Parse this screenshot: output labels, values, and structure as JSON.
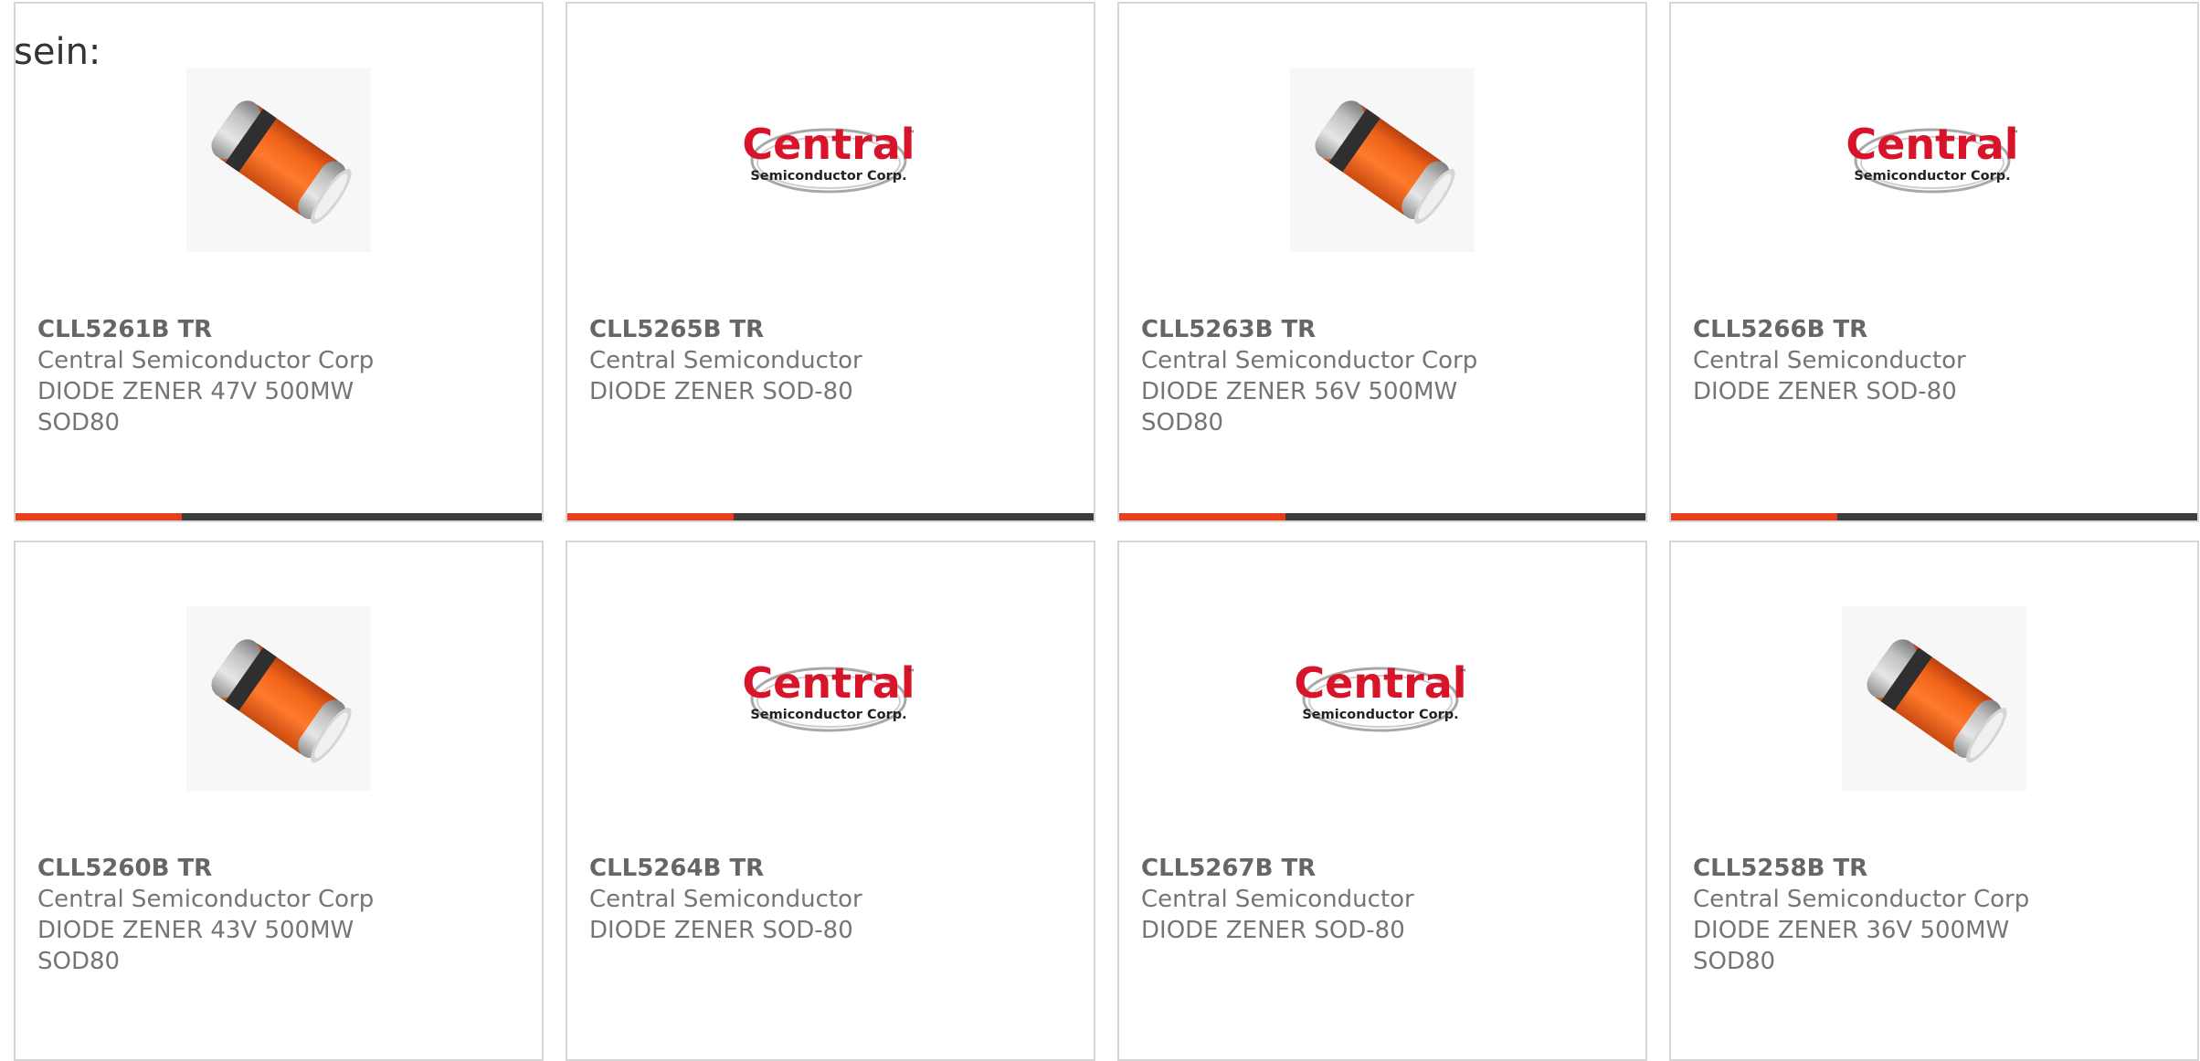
{
  "intro_text": "sein:",
  "colors": {
    "accent": "#e8401c",
    "bar": "#3d3d3d",
    "border": "#d6d6d6",
    "logo_red": "#d7142a"
  },
  "logo": {
    "word": "Central",
    "sub": "Semiconductor Corp.",
    "tm": "™"
  },
  "products": [
    {
      "part": "CLL5261B TR",
      "manufacturer": "Central Semiconductor Corp",
      "description": "DIODE ZENER 47V 500MW SOD80",
      "image": "diode-image",
      "show_bar": true
    },
    {
      "part": "CLL5265B TR",
      "manufacturer": "Central Semiconductor",
      "description": "DIODE ZENER SOD-80",
      "image": "central-logo",
      "show_bar": true
    },
    {
      "part": "CLL5263B TR",
      "manufacturer": "Central Semiconductor Corp",
      "description": "DIODE ZENER 56V 500MW SOD80",
      "image": "diode-image",
      "show_bar": true
    },
    {
      "part": "CLL5266B TR",
      "manufacturer": "Central Semiconductor",
      "description": "DIODE ZENER SOD-80",
      "image": "central-logo",
      "show_bar": true
    },
    {
      "part": "CLL5260B TR",
      "manufacturer": "Central Semiconductor Corp",
      "description": "DIODE ZENER 43V 500MW SOD80",
      "image": "diode-image",
      "show_bar": false
    },
    {
      "part": "CLL5264B TR",
      "manufacturer": "Central Semiconductor",
      "description": "DIODE ZENER SOD-80",
      "image": "central-logo",
      "show_bar": false
    },
    {
      "part": "CLL5267B TR",
      "manufacturer": "Central Semiconductor",
      "description": "DIODE ZENER SOD-80",
      "image": "central-logo",
      "show_bar": false
    },
    {
      "part": "CLL5258B TR",
      "manufacturer": "Central Semiconductor Corp",
      "description": "DIODE ZENER 36V 500MW SOD80",
      "image": "diode-image",
      "show_bar": false
    }
  ]
}
